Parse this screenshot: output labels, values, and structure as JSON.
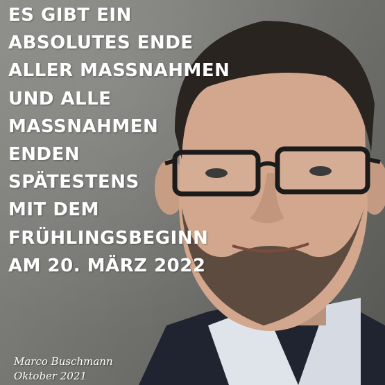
{
  "quote": {
    "lines": [
      "ES GIBT EIN",
      "ABSOLUTES ENDE",
      "ALLER MASSNAHMEN",
      "UND ALLE",
      "MASSNAHMEN",
      "ENDEN",
      "SPÄTESTENS",
      "MIT DEM",
      "FRÜHLINGSBEGINN",
      "AM 20. MÄRZ 2022"
    ]
  },
  "attribution": {
    "name": "Marco Buschmann",
    "date": "Oktober 2021"
  },
  "colors": {
    "text": "#ffffff",
    "background": "#7b7b78",
    "suit": "#1f2430",
    "shirt": "#dfe3ea"
  }
}
